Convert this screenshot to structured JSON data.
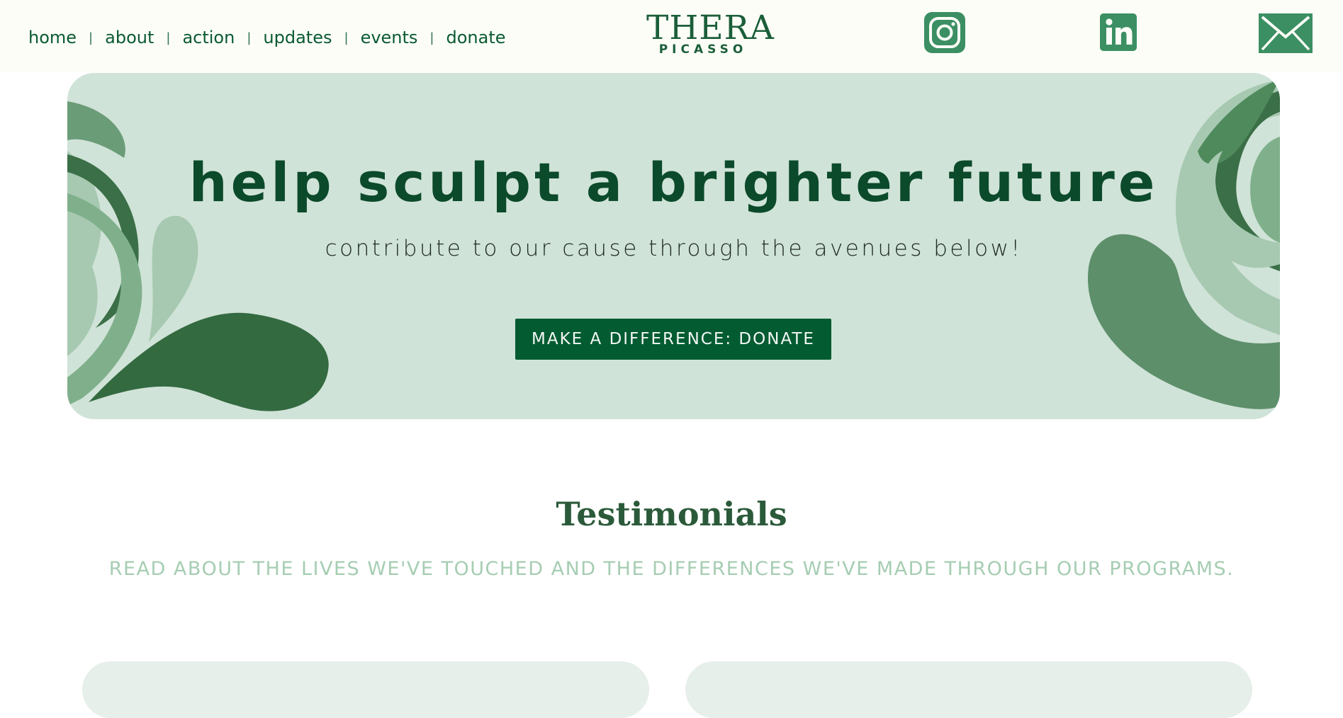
{
  "nav": {
    "items": [
      "home",
      "about",
      "action",
      "updates",
      "events",
      "donate"
    ],
    "separator": "|"
  },
  "logo": {
    "top": "THERA",
    "bottom": "PICASSO"
  },
  "social": [
    "instagram-icon",
    "linkedin-icon",
    "mail-icon"
  ],
  "hero": {
    "title": "help sculpt a brighter future",
    "subtitle": "contribute to our cause through the avenues below!",
    "cta_label": "MAKE A DIFFERENCE: DONATE"
  },
  "testimonials": {
    "title": "Testimonials",
    "subtitle": "READ ABOUT THE LIVES WE'VE TOUCHED AND THE DIFFERENCES WE'VE MADE THROUGH OUR PROGRAMS."
  },
  "colors": {
    "brand_green": "#035b32",
    "hero_bg": "#d0e3d8",
    "social_green": "#3b8f63"
  }
}
